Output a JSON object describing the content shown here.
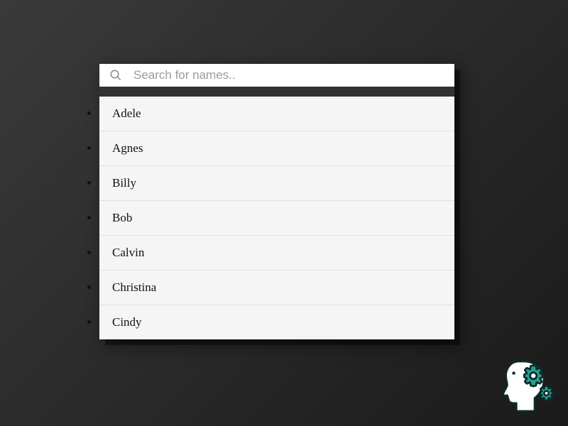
{
  "search": {
    "placeholder": "Search for names.."
  },
  "results": [
    {
      "name": "Adele"
    },
    {
      "name": "Agnes"
    },
    {
      "name": "Billy"
    },
    {
      "name": "Bob"
    },
    {
      "name": "Calvin"
    },
    {
      "name": "Christina"
    },
    {
      "name": "Cindy"
    }
  ],
  "colors": {
    "accent": "#2a9d8f"
  }
}
